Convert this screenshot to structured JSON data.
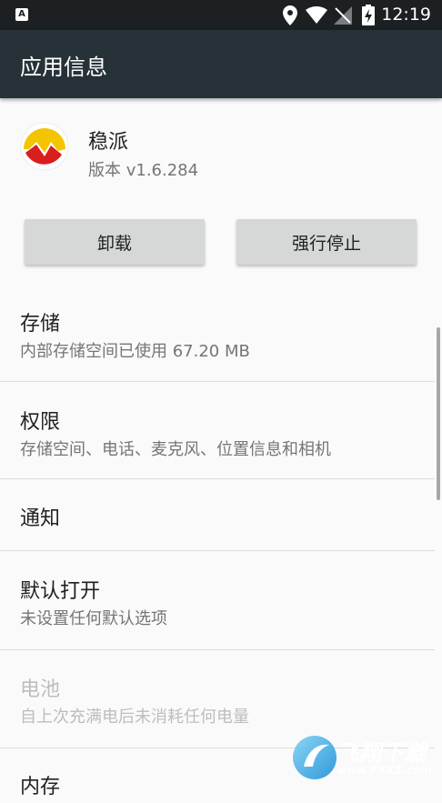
{
  "status_bar": {
    "notification_icon": "A",
    "time": "12:19",
    "icons": [
      "location-icon",
      "wifi-icon",
      "no-signal-icon",
      "battery-charging-icon"
    ]
  },
  "app_bar": {
    "title": "应用信息"
  },
  "app": {
    "name": "稳派",
    "version": "版本 v1.6.284",
    "brand_colors": {
      "yellow": "#f5c400",
      "red": "#d81e1e"
    }
  },
  "buttons": {
    "uninstall": "卸载",
    "force_stop": "强行停止"
  },
  "sections": [
    {
      "title": "存储",
      "subtitle": "内部存储空间已使用 67.20 MB",
      "enabled": true
    },
    {
      "title": "权限",
      "subtitle": "存储空间、电话、麦克风、位置信息和相机",
      "enabled": true
    },
    {
      "title": "通知",
      "subtitle": "",
      "enabled": true
    },
    {
      "title": "默认打开",
      "subtitle": "未设置任何默认选项",
      "enabled": true
    },
    {
      "title": "电池",
      "subtitle": "自上次充满电后未消耗任何电量",
      "enabled": false
    },
    {
      "title": "内存",
      "subtitle": "",
      "enabled": true
    }
  ],
  "watermark": {
    "text": "飞翔下载",
    "url": "www.FXXZ.com"
  },
  "colors": {
    "app_bar": "#263238",
    "status_bar": "#1c2023"
  }
}
